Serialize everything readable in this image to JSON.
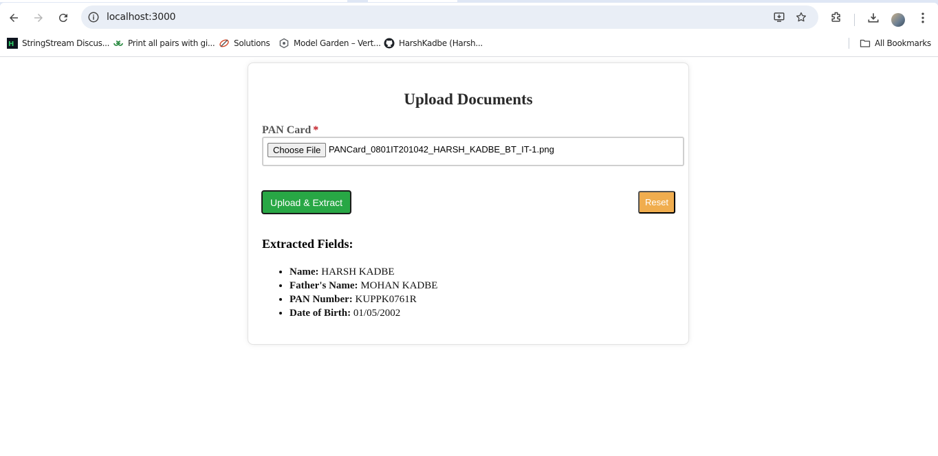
{
  "browser": {
    "url": "localhost:3000",
    "bookmarks": [
      {
        "label": "StringStream Discus...",
        "icon": "hackerrank-icon"
      },
      {
        "label": "Print all pairs with gi...",
        "icon": "geeksforgeeks-icon"
      },
      {
        "label": "Solutions",
        "icon": "solutions-icon"
      },
      {
        "label": "Model Garden – Vert...",
        "icon": "vertex-ai-icon"
      },
      {
        "label": "HarshKadbe (Harsh...",
        "icon": "github-icon"
      }
    ],
    "all_bookmarks_label": "All Bookmarks"
  },
  "page": {
    "title": "Upload Documents",
    "field_label": "PAN Card",
    "required_marker": "*",
    "file_button_label": "Choose File",
    "file_name": "PANCard_0801IT201042_HARSH_KADBE_BT_IT-1.png",
    "upload_button_label": "Upload & Extract",
    "reset_button_label": "Reset",
    "results_title": "Extracted Fields:",
    "fields": [
      {
        "label": "Name:",
        "value": "HARSH KADBE"
      },
      {
        "label": "Father's Name:",
        "value": "MOHAN KADBE"
      },
      {
        "label": "PAN Number:",
        "value": "KUPPK0761R"
      },
      {
        "label": "Date of Birth:",
        "value": "01/05/2002"
      }
    ]
  },
  "colors": {
    "upload_button": "#28a745",
    "reset_button": "#f0ad4e",
    "required_marker": "#c0151e"
  }
}
